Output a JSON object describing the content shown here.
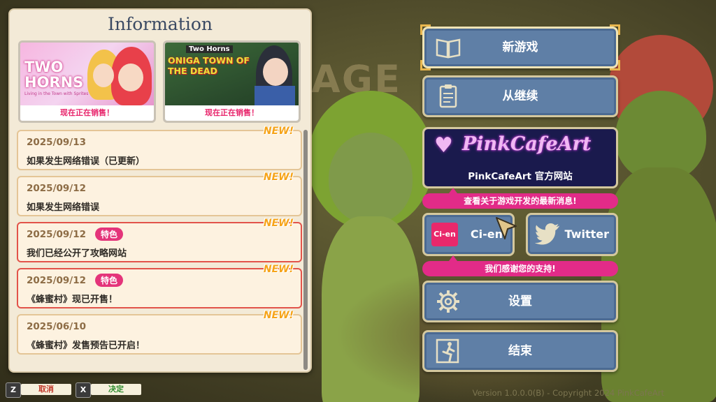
{
  "info_panel": {
    "title": "Information",
    "banners": [
      {
        "title": "TWO HORNS",
        "subtitle": "Living in the Town with Sprites",
        "tag": "现在正在销售！"
      },
      {
        "title_top": "Two Horns",
        "title": "ONIGA TOWN OF THE DEAD",
        "tag": "现在正在销售！"
      }
    ],
    "news": [
      {
        "date": "2025/09/13",
        "text": "如果发生网络错误（已更新）",
        "new_label": "NEW!",
        "featured": false
      },
      {
        "date": "2025/09/12",
        "text": "如果发生网络错误",
        "new_label": "NEW!",
        "featured": false
      },
      {
        "date": "2025/09/12",
        "text": "我们已经公开了攻略网站",
        "new_label": "NEW!",
        "featured": true,
        "feature_label": "特色"
      },
      {
        "date": "2025/09/12",
        "text": "《蜂蜜村》现已开售！",
        "new_label": "NEW!",
        "featured": true,
        "feature_label": "特色"
      },
      {
        "date": "2025/06/10",
        "text": "《蜂蜜村》发售预告已开启！",
        "new_label": "NEW!",
        "featured": false
      }
    ],
    "scroll_fraction": 1.0
  },
  "menu": {
    "new_game": "新游戏",
    "continue": "从继续",
    "pinkcafe_logo": "PinkCafeArt",
    "pinkcafe_site": "PinkCafeArt 官方网站",
    "pinkcafe_ribbon": "查看关于游戏开发的最新消息!",
    "cien": "Ci-en",
    "cien_icon": "Ci-en",
    "twitter": "Twitter",
    "support_ribbon": "我们感谢您的支持!",
    "settings": "设置",
    "exit": "结束"
  },
  "background": {
    "logo_fragment": "AGE"
  },
  "footer": {
    "cancel_key": "Z",
    "cancel_label": "取消",
    "confirm_key": "X",
    "confirm_label": "决定",
    "version": "Version 1.0.0.0(B) - Copyright 2024 PinkCafeArt"
  },
  "colors": {
    "button_blue": "#5f7fa6",
    "ribbon_pink": "#e22b88",
    "new_orange": "#f6a41a",
    "panel_bg": "#f3ead7"
  }
}
